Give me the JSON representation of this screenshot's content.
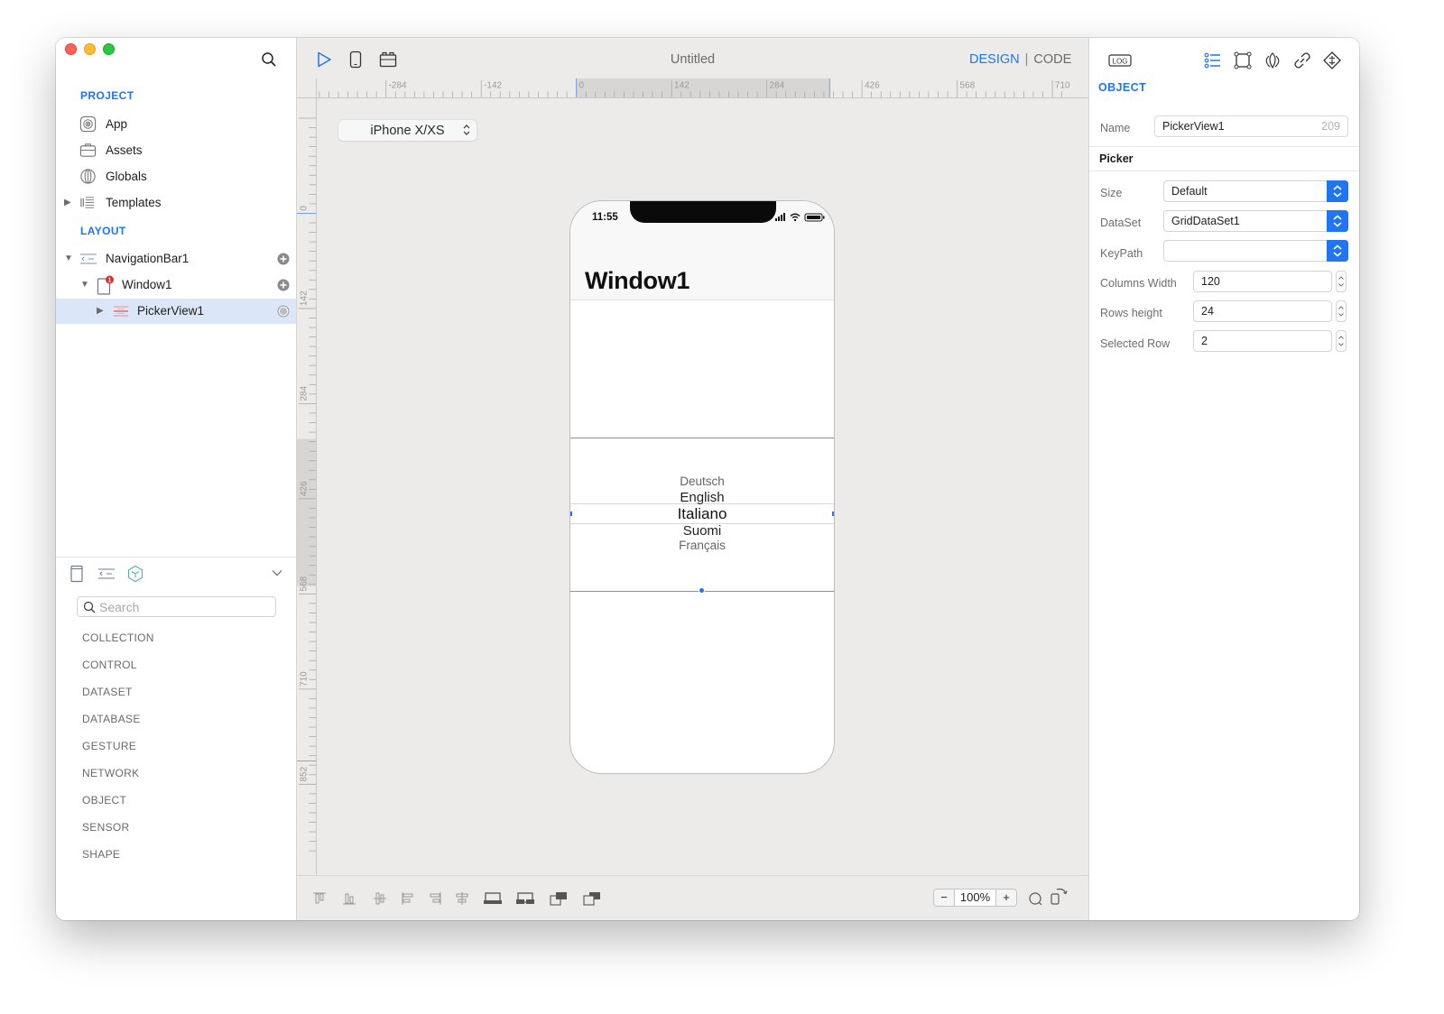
{
  "window": {
    "title": "Untitled",
    "modes": {
      "design": "DESIGN",
      "separator": "|",
      "code": "CODE",
      "active": "design"
    }
  },
  "sidebar": {
    "project_title": "PROJECT",
    "project_items": [
      {
        "label": "App",
        "icon": "app-icon"
      },
      {
        "label": "Assets",
        "icon": "briefcase-icon"
      },
      {
        "label": "Globals",
        "icon": "globe-icon"
      },
      {
        "label": "Templates",
        "icon": "templates-icon",
        "expandable": true
      }
    ],
    "layout_title": "LAYOUT",
    "layout_tree": [
      {
        "label": "NavigationBar1",
        "icon": "navigation-bar-icon",
        "expanded": true,
        "level": 0,
        "badge": null,
        "action": "add"
      },
      {
        "label": "Window1",
        "icon": "window-icon",
        "expanded": true,
        "level": 1,
        "badge": "1",
        "action": "add"
      },
      {
        "label": "PickerView1",
        "icon": "picker-view-icon",
        "expanded": false,
        "level": 2,
        "badge": null,
        "action": "radio",
        "selected": true
      }
    ],
    "library": {
      "search_placeholder": "Search",
      "categories": [
        "COLLECTION",
        "CONTROL",
        "DATASET",
        "DATABASE",
        "GESTURE",
        "NETWORK",
        "OBJECT",
        "SENSOR",
        "SHAPE"
      ]
    }
  },
  "canvas": {
    "device": "iPhone X/XS",
    "ruler_h_labels": [
      "-284",
      "-142",
      "0",
      "142",
      "284",
      "426",
      "568",
      "710"
    ],
    "ruler_v_labels": [
      "0",
      "142",
      "284",
      "426",
      "568",
      "710",
      "852"
    ],
    "zoom": "100%",
    "zoom_minus": "−",
    "zoom_plus": "+",
    "phone": {
      "status_time": "11:55",
      "window_title": "Window1",
      "picker_rows": [
        "Deutsch",
        "English",
        "Italiano",
        "Suomi",
        "Français"
      ],
      "picker_selected_index": 2
    }
  },
  "inspector": {
    "title": "OBJECT",
    "name_label": "Name",
    "name_value": "PickerView1",
    "name_counter": "209",
    "section": "Picker",
    "fields": {
      "size": {
        "label": "Size",
        "value": "Default"
      },
      "dataset": {
        "label": "DataSet",
        "value": "GridDataSet1"
      },
      "keypath": {
        "label": "KeyPath",
        "value": ""
      },
      "columns_width": {
        "label": "Columns Width",
        "value": "120"
      },
      "rows_height": {
        "label": "Rows height",
        "value": "24"
      },
      "selected_row": {
        "label": "Selected Row",
        "value": "2"
      }
    },
    "log_label": "LOG"
  },
  "colors": {
    "accent": "#1f75f2",
    "selection_row": "#dbe7f8",
    "badge": "#e02b2b"
  }
}
